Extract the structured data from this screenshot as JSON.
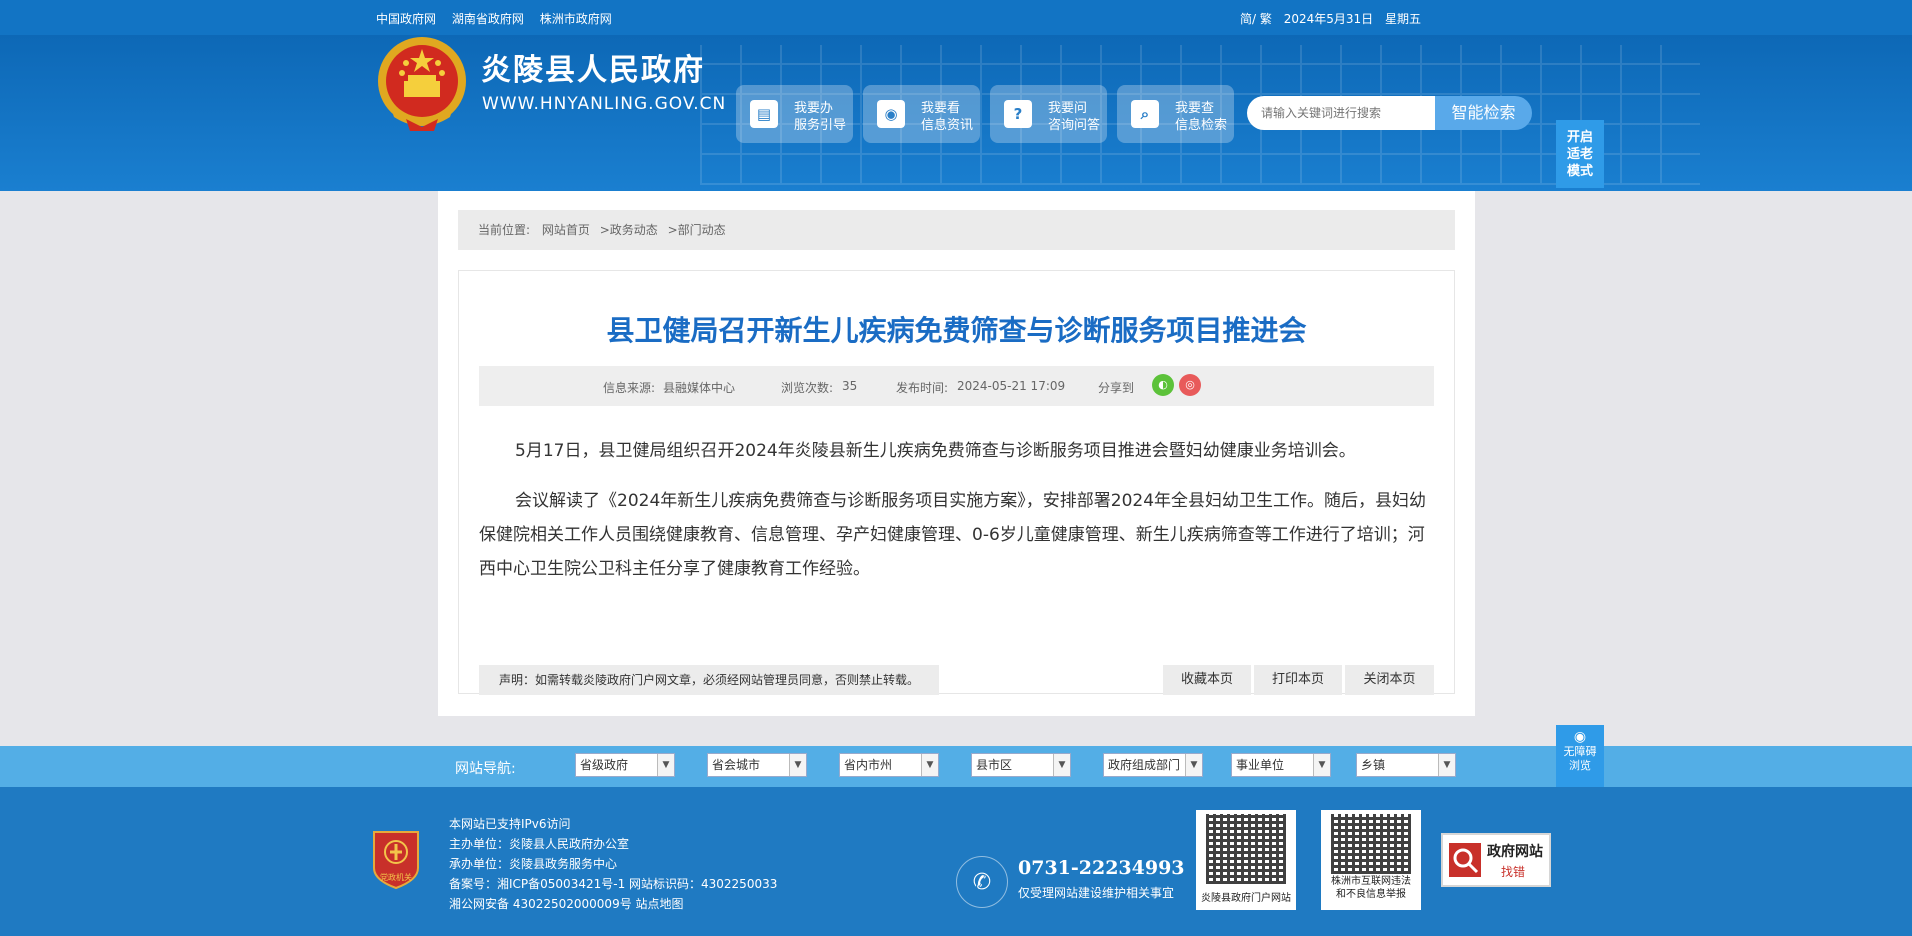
{
  "topbar": {
    "links": [
      "中国政府网",
      "湖南省政府网",
      "株洲市政府网"
    ],
    "lang": "简/ 繁",
    "date": "2024年5月31日",
    "weekday": "星期五"
  },
  "header": {
    "site_name": "炎陵县人民政府",
    "site_url": "WWW.HNYANLING.GOV.CN",
    "services": [
      {
        "icon": "document-icon",
        "line1": "我要办",
        "line2": "服务引导"
      },
      {
        "icon": "eye-icon",
        "line1": "我要看",
        "line2": "信息资讯"
      },
      {
        "icon": "question-icon",
        "line1": "我要问",
        "line2": "咨询问答"
      },
      {
        "icon": "search-icon",
        "line1": "我要查",
        "line2": "信息检索"
      }
    ],
    "search_placeholder": "请输入关键词进行搜索",
    "search_button": "智能检索",
    "elder_mode": "开启适老模式"
  },
  "breadcrumb": {
    "prefix": "当前位置:",
    "items": [
      "网站首页",
      ">政务动态",
      ">部门动态"
    ]
  },
  "article": {
    "title": "县卫健局召开新生儿疾病免费筛查与诊断服务项目推进会",
    "source_label": "信息来源:",
    "source": "县融媒体中心",
    "views_label": "浏览次数:",
    "views": "35",
    "time_label": "发布时间:",
    "time": "2024-05-21 17:09",
    "share_label": "分享到",
    "paragraphs": [
      "5月17日，县卫健局组织召开2024年炎陵县新生儿疾病免费筛查与诊断服务项目推进会暨妇幼健康业务培训会。",
      "会议解读了《2024年新生儿疾病免费筛查与诊断服务项目实施方案》，安排部署2024年全县妇幼卫生工作。随后，县妇幼保健院相关工作人员围绕健康教育、信息管理、孕产妇健康管理、0-6岁儿童健康管理、新生儿疾病筛查等工作进行了培训；河西中心卫生院公卫科主任分享了健康教育工作经验。"
    ],
    "notice": "声明：如需转载炎陵政府门户网文章，必须经网站管理员同意，否则禁止转载。",
    "actions": [
      "收藏本页",
      "打印本页",
      "关闭本页"
    ]
  },
  "nav": {
    "label": "网站导航:",
    "selects": [
      "省级政府",
      "省会城市",
      "省内市州",
      "县市区",
      "政府组成部门",
      "事业单位",
      "乡镇"
    ],
    "accessibility": [
      "无障碍",
      "浏览"
    ]
  },
  "footer": {
    "badge_text": "党政机关",
    "ipv6": "本网站已支持IPv6访问",
    "sponsor": "主办单位：炎陵县人民政府办公室",
    "organizer": "承办单位：炎陵县政务服务中心",
    "icp": "备案号：湘ICP备05003421号-1 网站标识码：4302250033",
    "police": "湘公网安备 43022502000009号 站点地图",
    "phone": "0731-22234993",
    "phone_note": "仅受理网站建设维护相关事宜",
    "qr1_caption": "炎陵县政府门户网站",
    "qr2_caption_1": "株洲市互联网违法",
    "qr2_caption_2": "和不良信息举报",
    "jiucuo_1": "政府网站",
    "jiucuo_2": "找错"
  },
  "colors": {
    "brand_blue": "#1274c4",
    "title_blue": "#1a6cc4",
    "nav_blue": "#53aee6",
    "footer_blue": "#1f7ac2"
  }
}
